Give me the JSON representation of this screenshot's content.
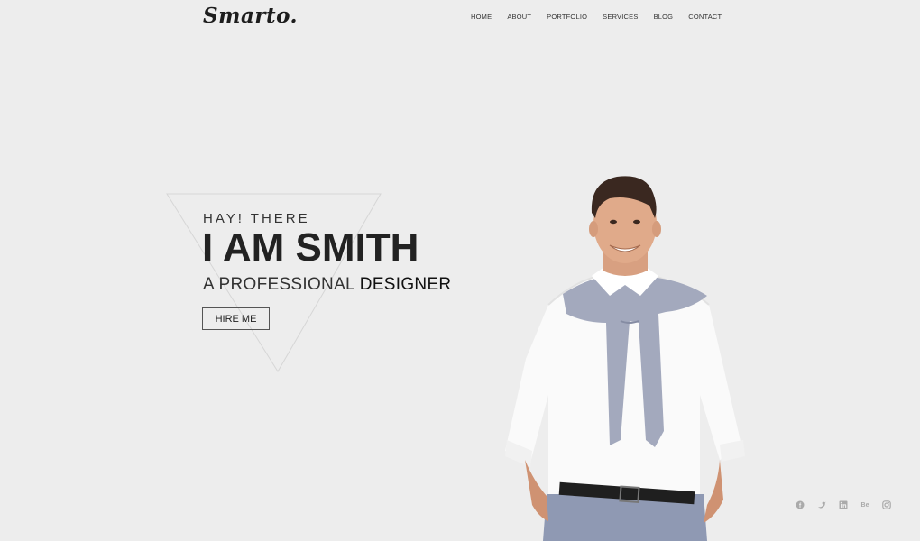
{
  "brand": {
    "logo": "Smarto."
  },
  "nav": {
    "items": [
      "HOME",
      "ABOUT",
      "PORTFOLIO",
      "SERVICES",
      "BLOG",
      "CONTACT"
    ]
  },
  "hero": {
    "greeting": "HAY! THERE",
    "name": "I AM SMITH",
    "role_prefix": "A PROFESSIONAL ",
    "role_highlight": "DESIGNER",
    "cta_label": "HIRE ME"
  },
  "social": {
    "icons": [
      "facebook-icon",
      "twitter-icon",
      "linkedin-icon",
      "behance-icon",
      "instagram-icon"
    ],
    "behance_text": "Be"
  },
  "colors": {
    "background": "#ededed",
    "text": "#222222",
    "icon": "#aaaaaa"
  }
}
